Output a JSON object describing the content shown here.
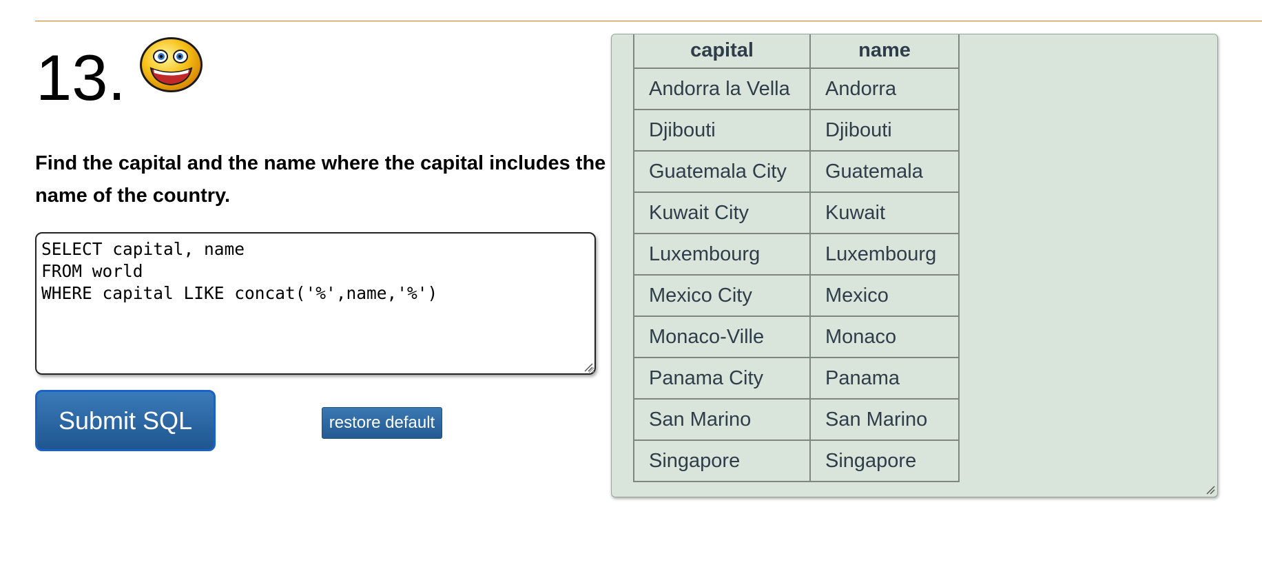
{
  "question": {
    "number": "13.",
    "emoji": "smiley-face-icon",
    "text": "Find the capital and the name where the capital includes the name of the country."
  },
  "editor": {
    "sql": "SELECT capital, name\nFROM world\nWHERE capital LIKE concat('%',name,'%')"
  },
  "buttons": {
    "submit_label": "Submit SQL",
    "restore_label": "restore default"
  },
  "results": {
    "headers": [
      "capital",
      "name"
    ],
    "rows": [
      [
        "Andorra la Vella",
        "Andorra"
      ],
      [
        "Djibouti",
        "Djibouti"
      ],
      [
        "Guatemala City",
        "Guatemala"
      ],
      [
        "Kuwait City",
        "Kuwait"
      ],
      [
        "Luxembourg",
        "Luxembourg"
      ],
      [
        "Mexico City",
        "Mexico"
      ],
      [
        "Monaco-Ville",
        "Monaco"
      ],
      [
        "Panama City",
        "Panama"
      ],
      [
        "San Marino",
        "San Marino"
      ],
      [
        "Singapore",
        "Singapore"
      ]
    ]
  },
  "colors": {
    "accent_rule": "#e07a10",
    "button_blue": "#1f5690",
    "result_background": "#d9e5da"
  }
}
